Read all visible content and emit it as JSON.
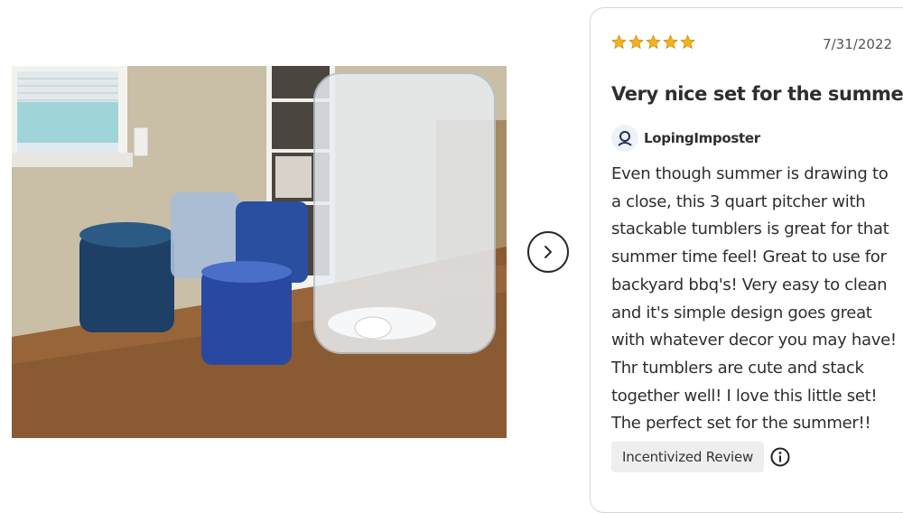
{
  "review": {
    "rating": 5,
    "max_rating": 5,
    "star_color": "#f3b21e",
    "date": "7/31/2022",
    "title": "Very nice set for the summer",
    "author": "LopingImposter",
    "body": "Even though summer is drawing to a close, this 3 quart pitcher with stackable tumblers is great for that summer time feel! Great to use for backyard bbq's! Very easy to clean and it's simple design goes great with whatever decor you may have! Thr tumblers are cute and stack together well! I love this little set! The perfect set for the summer!!",
    "badge": "Incentivized Review"
  },
  "icons": {
    "next": "chevron-right-icon",
    "avatar": "user-icon",
    "info": "info-icon",
    "star": "star-icon"
  }
}
